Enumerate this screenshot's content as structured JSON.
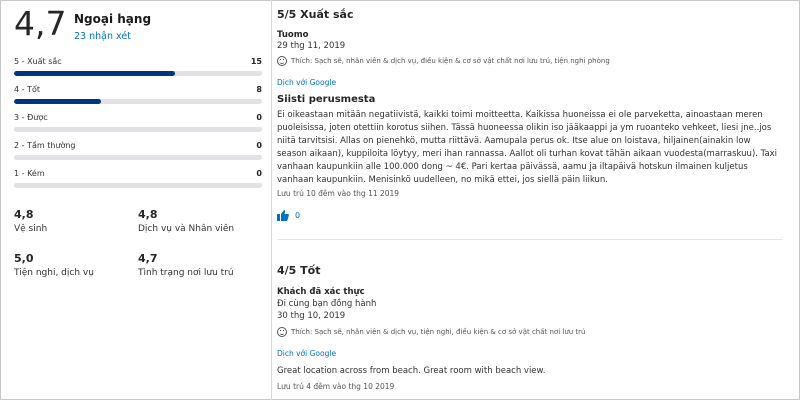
{
  "summary": {
    "score": "4,7",
    "score_word": "Ngoại hạng",
    "review_count": "23 nhận xét"
  },
  "distribution": [
    {
      "label": "5 - Xuất sắc",
      "count": "15",
      "fraction": 0.65
    },
    {
      "label": "4 - Tốt",
      "count": "8",
      "fraction": 0.35
    },
    {
      "label": "3 - Được",
      "count": "0",
      "fraction": 0
    },
    {
      "label": "2 - Tầm thường",
      "count": "0",
      "fraction": 0
    },
    {
      "label": "1 - Kém",
      "count": "0",
      "fraction": 0
    }
  ],
  "categories": [
    {
      "score": "4,8",
      "label": "Vệ sinh"
    },
    {
      "score": "4,8",
      "label": "Dịch vụ và Nhân viên"
    },
    {
      "score": "5,0",
      "label": "Tiện nghi, dịch vụ"
    },
    {
      "score": "4,7",
      "label": "Tình trạng nơi lưu trú"
    }
  ],
  "reviews": [
    {
      "title": "5/5 Xuất sắc",
      "author": "Tuomo",
      "date": "29 thg 11, 2019",
      "likes": "Thích: Sạch sẽ, nhân viên & dịch vụ, điều kiện & cơ sở vật chất nơi lưu trú, tiện nghi phòng",
      "translate": "Dịch với Google",
      "subtitle": "Siisti perusmesta",
      "body": "Ei oikeastaan mitään negatiivistä, kaikki toimi moitteetta. Kaikissa huoneissa ei ole parveketta, ainoastaan meren puoleisissa, joten otettiin korotus siihen. Tässä huoneessa olikin iso jääkaappi ja ym ruoanteko vehkeet, liesi jne..jos niitä tarvitsisi. Allas on pienehkö, mutta riittävä. Aamupala perus ok. Itse alue on loistava, hiljainen(ainakin low season aikaan), kuppiloita löytyy, meri ihan rannassa. Aallot oli turhan kovat tähän aikaan vuodesta(marraskuu). Taxi vanhaan kaupunkiin alle 100.000 dong ~ 4€. Pari kertaa päivässä, aamu ja iltapäivä hotskun ilmainen kuljetus vanhaan kaupunkiin. Menisinkö uudelleen, no mikä ettei, jos siellä päin liikun.",
      "stay": "Lưu trú 10 đêm vào thg 11 2019",
      "helpful": "0"
    },
    {
      "title": "4/5 Tốt",
      "author": "Khách đã xác thực",
      "traveler": "Đi cùng bạn đồng hành",
      "date": "30 thg 10, 2019",
      "likes": "Thích: Sạch sẽ, nhân viên & dịch vụ, tiện nghi, điều kiện & cơ sở vật chất nơi lưu trú",
      "translate": "Dịch với Google",
      "body": "Great location across from beach. Great room with beach view.",
      "stay": "Lưu trú 4 đêm vào thg 10 2019"
    }
  ],
  "colors": {
    "brand": "#003580",
    "link": "#0071c2",
    "track": "#e2e2e6"
  }
}
